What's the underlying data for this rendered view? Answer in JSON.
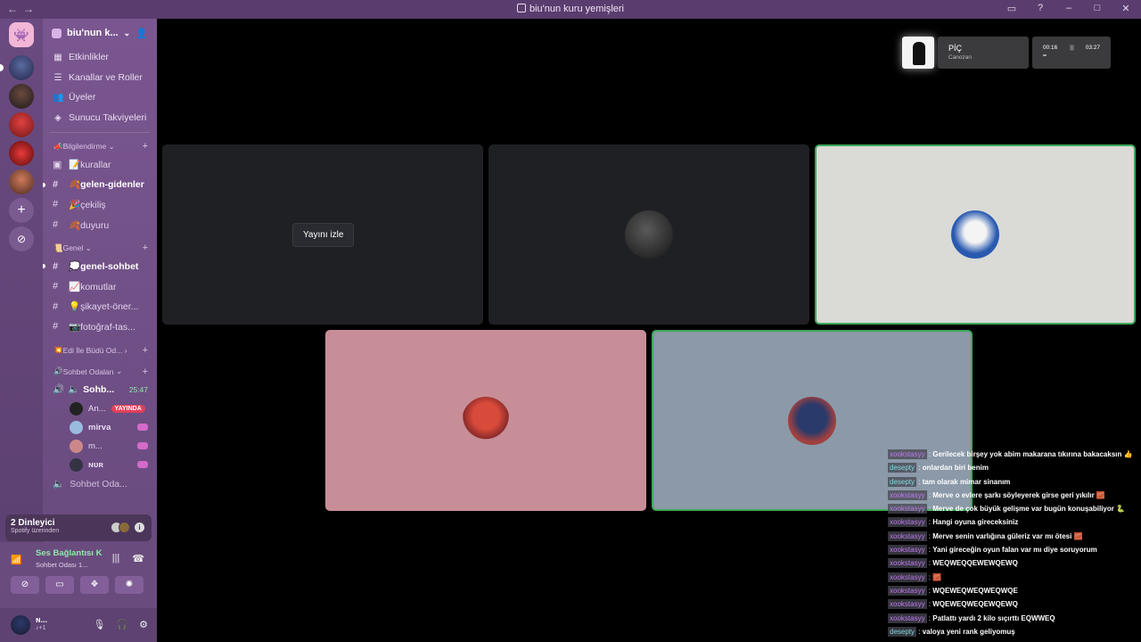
{
  "window": {
    "title": "biu'nun kuru yemişleri",
    "nav_back": "←",
    "nav_fwd": "→"
  },
  "server": {
    "name": "biu'nun k...",
    "menu": [
      "Etkinlikler",
      "Kanallar ve Roller",
      "Üyeler",
      "Sunucu Takviyeleri"
    ]
  },
  "categories": {
    "bilgi": "Bilgilendirme",
    "genel": "Genel",
    "edi": "Edi İle Büdü Od...",
    "sohbet": "Sohbet Odaları"
  },
  "channels_info": [
    {
      "label": "📝kurallar",
      "unread": false
    },
    {
      "label": "🍂gelen-gidenler",
      "unread": true
    },
    {
      "label": "🎉çekiliş",
      "unread": false
    },
    {
      "label": "🍂duyuru",
      "unread": false
    }
  ],
  "channels_genel": [
    {
      "label": "💭genel-sohbet",
      "unread": true
    },
    {
      "label": "📈komutlar",
      "unread": false
    },
    {
      "label": "💡şikayet-öner...",
      "unread": false
    },
    {
      "label": "📷fotoğraf-tas...",
      "unread": false
    }
  ],
  "voice": {
    "channel": "Sohb...",
    "timer": "25:47",
    "members": [
      {
        "name": "An...",
        "live": "YAYINDA"
      },
      {
        "name": "mirva"
      },
      {
        "name": "m..."
      },
      {
        "name": "ɴᴜʀ"
      }
    ],
    "next_channel": "Sohbet Oda..."
  },
  "spotify": {
    "title": "2 Dinleyici",
    "subtitle": "Spotify üzerinden",
    "info": "i"
  },
  "connection": {
    "status": "Ses Bağlantısı K",
    "sub": "Sohbet Odası 1..."
  },
  "user": {
    "name": "ɴ...",
    "status": "♪+1"
  },
  "stage": {
    "watch_label": "Yayını izle"
  },
  "now_playing": {
    "song": "PİÇ",
    "artist": "Canozan",
    "elapsed": "00:16",
    "total": "03:27"
  },
  "chat": [
    {
      "name": "xookstasyy",
      "color": "p",
      "text": "Gerilecek birşey yok abim makarana tıkırına bakacaksın 👍"
    },
    {
      "name": "desepty",
      "color": "c",
      "text": "onlardan biri benim"
    },
    {
      "name": "desepty",
      "color": "c",
      "text": "tam olarak mimar sinanım"
    },
    {
      "name": "xookstasyy",
      "color": "p",
      "text": "Merve o evlere şarkı söyleyerek girse geri yıkılır 🧱"
    },
    {
      "name": "xookstasyy",
      "color": "p",
      "text": "Merve de çok büyük gelişme var bugün konuşabiliyor 🐍"
    },
    {
      "name": "xookstasyy",
      "color": "p",
      "text": "Hangi oyuna gireceksiniz"
    },
    {
      "name": "xookstasyy",
      "color": "p",
      "text": "Merve senin varlığına güleriz var mı ötesi 🧱"
    },
    {
      "name": "xookstasyy",
      "color": "p",
      "text": "Yani gireceğin oyun falan var mı diye soruyorum"
    },
    {
      "name": "xookstasyy",
      "color": "p",
      "text": "WEQWEQQEWEWQEWQ"
    },
    {
      "name": "xookstasyy",
      "color": "p",
      "text": "🧱"
    },
    {
      "name": "xookstasyy",
      "color": "p",
      "text": "WQEWEQWEQWEQWQE"
    },
    {
      "name": "xookstasyy",
      "color": "p",
      "text": "WQEWEQWEQEWQEWQ"
    },
    {
      "name": "xookstasyy",
      "color": "p",
      "text": "Patlattı yardı 2 kilo sıçırttı EQWWEQ"
    },
    {
      "name": "desepty",
      "color": "c",
      "text": "valoya yeni rank geliyomuş"
    }
  ]
}
